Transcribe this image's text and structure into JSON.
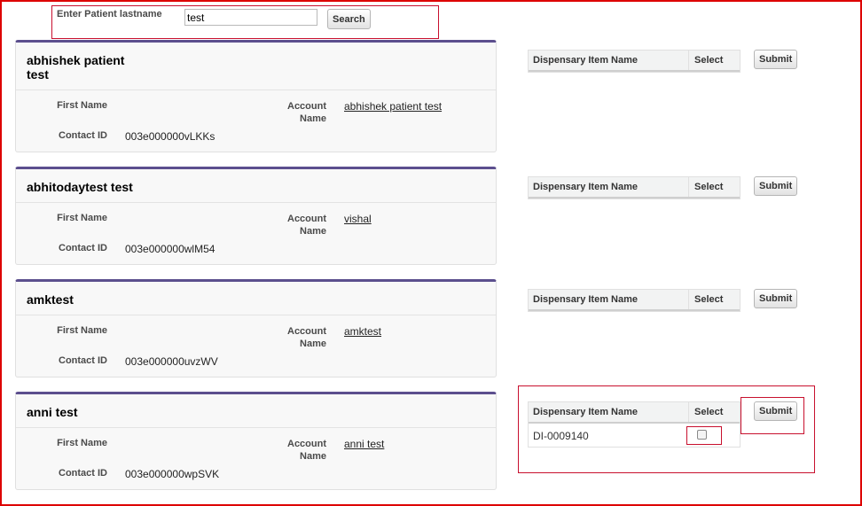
{
  "search": {
    "label": "Enter Patient lastname",
    "value": "test",
    "button_label": "Search"
  },
  "field_labels": {
    "first_name": "First Name",
    "account_name_line1": "Account",
    "account_name_line2": "Name",
    "contact_id": "Contact ID"
  },
  "dispensary": {
    "col_item_name": "Dispensary Item Name",
    "col_select": "Select",
    "submit_label": "Submit"
  },
  "patients": [
    {
      "name_line1": "abhishek patient",
      "name_line2": "test",
      "first_name": "",
      "account_name": "abhishek patient test",
      "contact_id": "003e000000vLKKs",
      "dispensary_items": []
    },
    {
      "name_line1": "abhitodaytest test",
      "name_line2": "",
      "first_name": "",
      "account_name": "vishal",
      "contact_id": "003e000000wlM54",
      "dispensary_items": []
    },
    {
      "name_line1": "amktest",
      "name_line2": "",
      "first_name": "",
      "account_name": "amktest",
      "contact_id": "003e000000uvzWV",
      "dispensary_items": []
    },
    {
      "name_line1": "anni test",
      "name_line2": "",
      "first_name": "",
      "account_name": "anni test",
      "contact_id": "003e000000wpSVK",
      "dispensary_items": [
        {
          "name": "DI-0009140",
          "selected": false
        }
      ]
    }
  ]
}
